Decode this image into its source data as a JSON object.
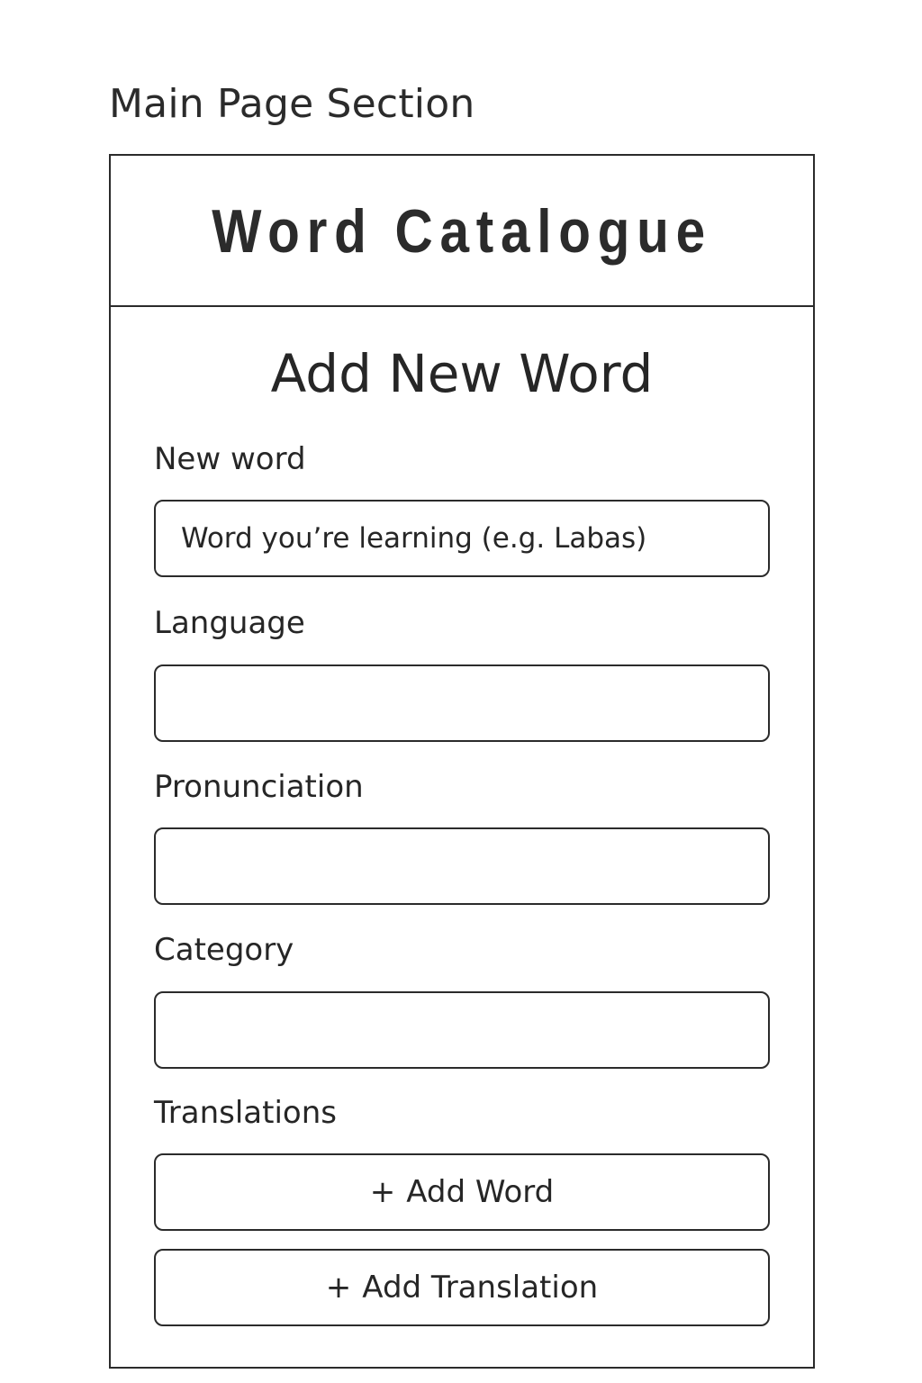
{
  "section_caption": "Main Page Section",
  "header": {
    "title": "Word Catalogue"
  },
  "form": {
    "title": "Add New Word",
    "fields": {
      "new_word": {
        "label": "New word",
        "placeholder": "Word you’re learning (e.g. Labas)",
        "value": ""
      },
      "language": {
        "label": "Language",
        "placeholder": "",
        "value": ""
      },
      "pronunciation": {
        "label": "Pronunciation",
        "placeholder": "",
        "value": ""
      },
      "category": {
        "label": "Category",
        "placeholder": "",
        "value": ""
      }
    },
    "translations": {
      "label": "Translations",
      "add_word_label": "Add Word",
      "add_translation_label": "Add Translation",
      "plus_icon": "plus-icon",
      "plus_glyph": "+"
    }
  },
  "colors": {
    "border": "#2b2b2b",
    "text": "#262626",
    "background": "#ffffff"
  }
}
